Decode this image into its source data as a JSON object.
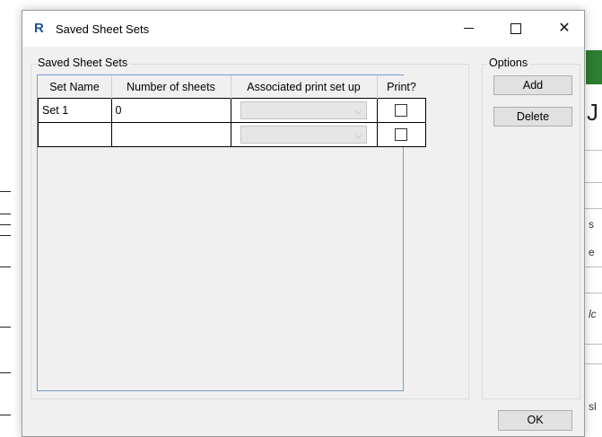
{
  "window": {
    "title": "Saved Sheet Sets",
    "app_icon_letter": "R",
    "brand_color": "#1d4f9c"
  },
  "window_controls": {
    "minimize": "minimize",
    "maximize": "maximize",
    "close": "✕"
  },
  "main_group": {
    "label": "Saved Sheet Sets",
    "columns": [
      "Set Name",
      "Number of sheets",
      "Associated print set up",
      "Print?"
    ],
    "rows": [
      {
        "set_name": "Set 1",
        "number_of_sheets": "0",
        "print_setup": "",
        "print": false
      },
      {
        "set_name": "",
        "number_of_sheets": "",
        "print_setup": "",
        "print": false
      }
    ]
  },
  "options_group": {
    "label": "Options",
    "add_label": "Add",
    "delete_label": "Delete"
  },
  "footer": {
    "ok_label": "OK"
  },
  "background": {
    "right_chars": [
      "J",
      "s",
      "e",
      "lc",
      "sl"
    ]
  }
}
